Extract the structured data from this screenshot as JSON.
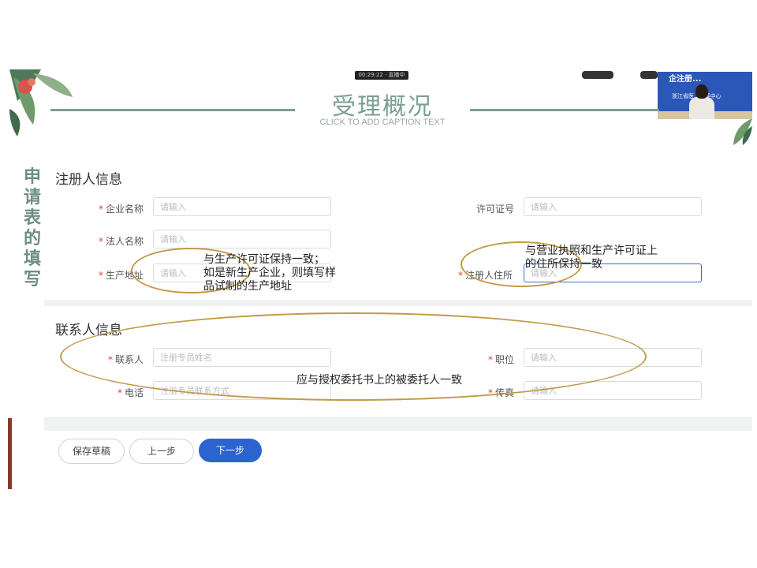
{
  "slide": {
    "title": "受理概况",
    "caption": "CLICK TO ADD CAPTION TEXT",
    "vertical_title": "申请表的填写"
  },
  "meeting": {
    "timer": "00:29:22 · 直播中",
    "webcam_banner_top": "企注册...",
    "webcam_banner_sub": "浙江省医...审评中心"
  },
  "form": {
    "section1_title": "注册人信息",
    "section2_title": "联系人信息",
    "fields": {
      "company_name": {
        "label": "企业名称",
        "placeholder": "请输入",
        "required": "*"
      },
      "license_no": {
        "label": "许可证号",
        "placeholder": "请输入"
      },
      "legal_person": {
        "label": "法人名称",
        "placeholder": "请输入",
        "required": "*"
      },
      "production_address": {
        "label": "生产地址",
        "placeholder": "请输入",
        "required": "*"
      },
      "registrant_address": {
        "label": "注册人住所",
        "placeholder": "请输入",
        "required": "*"
      },
      "contact": {
        "label": "联系人",
        "placeholder": "注册专员姓名",
        "required": "*"
      },
      "position": {
        "label": "职位",
        "placeholder": "请输入",
        "required": "*"
      },
      "phone": {
        "label": "电话",
        "placeholder": "注册专员联系方式",
        "required": "*"
      },
      "fax": {
        "label": "传真",
        "placeholder": "请输入",
        "required": "*"
      }
    },
    "buttons": {
      "save_draft": "保存草稿",
      "prev": "上一步",
      "next": "下一步"
    }
  },
  "annotations": {
    "production_address_note_1": "与生产许可证保持一致；",
    "production_address_note_2": "如是新生产企业，则填写样",
    "production_address_note_3": "品试制的生产地址",
    "registrant_address_note_1": "与营业执照和生产许可证上",
    "registrant_address_note_2": "的住所保持一致",
    "contact_note": "应与授权委托书上的被委托人一致"
  },
  "colors": {
    "accent_green": "#7aa090",
    "primary_blue": "#2b64cf",
    "required_red": "#e0443a",
    "annotation_ring": "#c39a48"
  }
}
